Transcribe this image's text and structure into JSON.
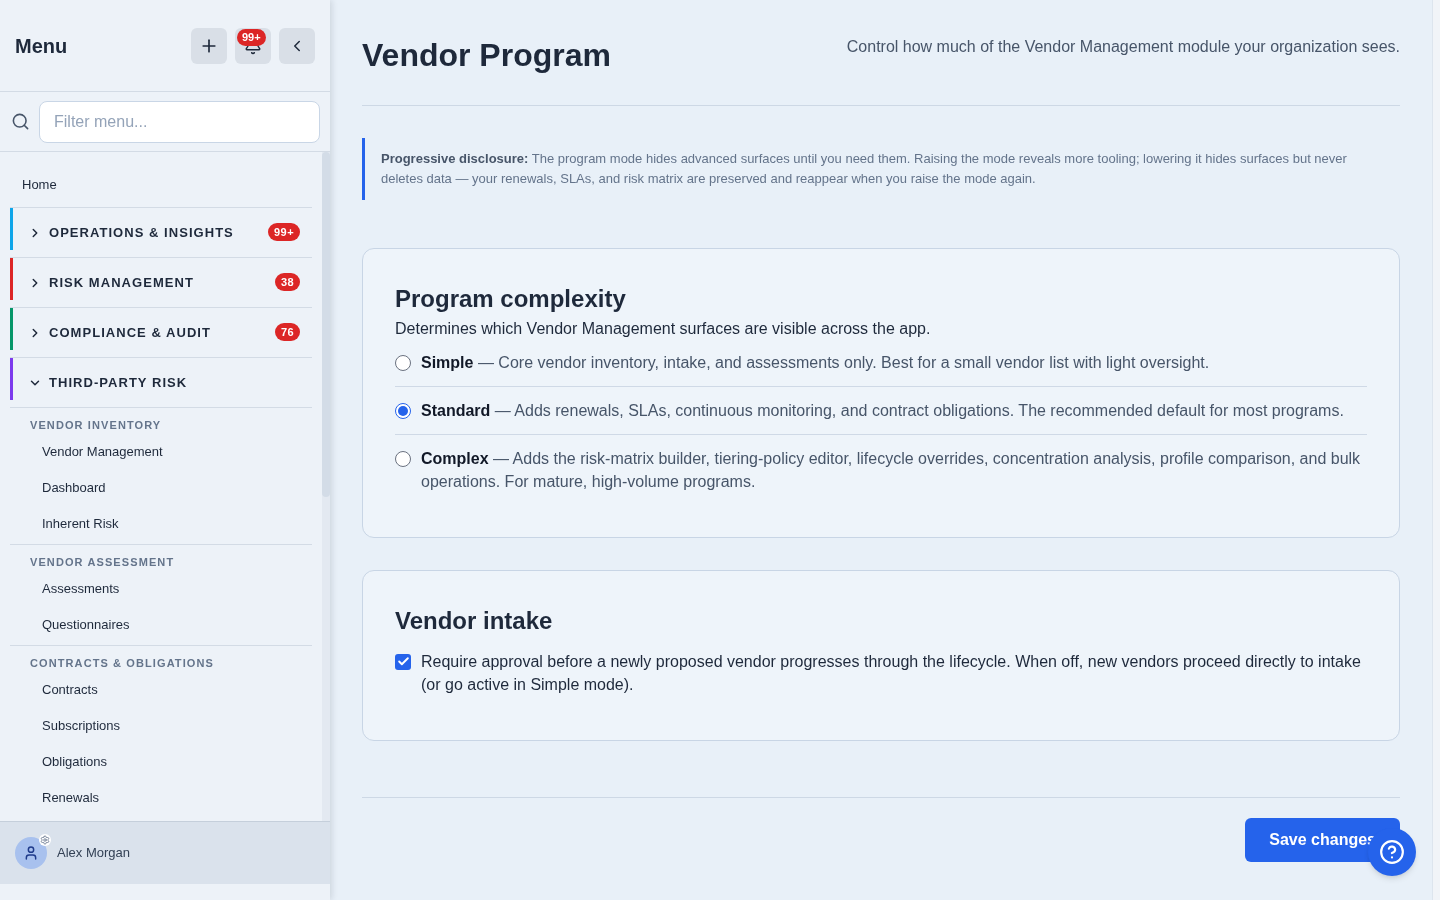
{
  "sidebar": {
    "title": "Menu",
    "notifications_badge": "99+",
    "search": {
      "placeholder": "Filter menu..."
    },
    "items": [
      {
        "kind": "link",
        "label": "Home"
      },
      {
        "kind": "group",
        "label": "OPERATIONS & INSIGHTS",
        "color": "#0ea5e9",
        "badge": "99+",
        "expanded": false
      },
      {
        "kind": "group",
        "label": "RISK MANAGEMENT",
        "color": "#dc2626",
        "badge": "38",
        "expanded": false
      },
      {
        "kind": "group",
        "label": "COMPLIANCE & AUDIT",
        "color": "#059669",
        "badge": "76",
        "expanded": false
      },
      {
        "kind": "group",
        "label": "THIRD-PARTY RISK",
        "color": "#7c3aed",
        "expanded": true,
        "sections": [
          {
            "heading": "VENDOR INVENTORY",
            "items": [
              "Vendor Management",
              "Dashboard",
              "Inherent Risk"
            ]
          },
          {
            "heading": "VENDOR ASSESSMENT",
            "items": [
              "Assessments",
              "Questionnaires"
            ]
          },
          {
            "heading": "CONTRACTS & OBLIGATIONS",
            "items": [
              "Contracts",
              "Subscriptions",
              "Obligations",
              "Renewals"
            ]
          }
        ]
      }
    ],
    "user": {
      "name": "Alex Morgan"
    }
  },
  "page": {
    "title": "Vendor Program",
    "subtitle": "Control how much of the Vendor Management module your organization sees.",
    "callout": "**Progressive disclosure:** The program mode hides advanced surfaces until you need them. Raising the mode reveals more tooling; lowering it hides surfaces but never deletes data — your renewals, SLAs, and risk matrix are preserved and reappear when you raise the mode again."
  },
  "cards": [
    {
      "kind": "radio-group",
      "title": "Program complexity",
      "description": "Determines which Vendor Management surfaces are visible across the app.",
      "options": [
        {
          "text": "**Simple** — Core vendor inventory, intake, and assessments only. Best for a small vendor list with light oversight.",
          "selected": false
        },
        {
          "text": "**Standard** — Adds renewals, SLAs, continuous monitoring, and contract obligations. The recommended default for most programs.",
          "selected": true
        },
        {
          "text": "**Complex** — Adds the risk-matrix builder, tiering-policy editor, lifecycle overrides, concentration analysis, profile comparison, and bulk operations. For mature, high-volume programs.",
          "selected": false
        }
      ]
    },
    {
      "kind": "checkbox",
      "title": "Vendor intake",
      "label": "Require approval before a newly proposed vendor progresses through the lifecycle. When off, new vendors proceed directly to intake (or go active in Simple mode).",
      "checked": true
    }
  ],
  "actions": {
    "save": "Save changes"
  }
}
